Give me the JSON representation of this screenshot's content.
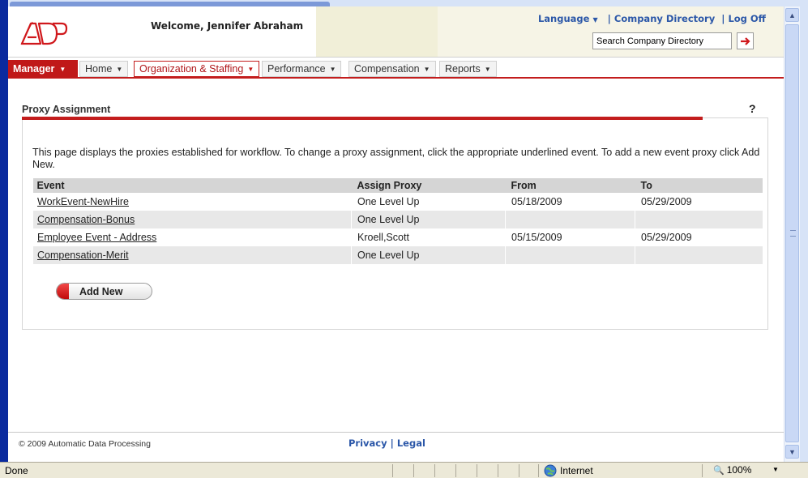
{
  "header": {
    "welcome": "Welcome, Jennifer Abraham",
    "language_label": "Language",
    "company_directory_link": "Company Directory",
    "logoff_link": "Log Off",
    "search_value": "Search Company Directory"
  },
  "nav": {
    "manager": "Manager",
    "home": "Home",
    "organization_staffing": "Organization & Staffing",
    "performance": "Performance",
    "compensation": "Compensation",
    "reports": "Reports"
  },
  "page": {
    "title": "Proxy Assignment",
    "help": "?",
    "intro": "This page displays the proxies established for workflow. To change a proxy assignment, click the appropriate underlined event. To add a new event proxy click Add New.",
    "add_new_label": "Add New"
  },
  "table": {
    "headers": {
      "event": "Event",
      "proxy": "Assign Proxy",
      "from": "From",
      "to": "To"
    },
    "rows": [
      {
        "event": "WorkEvent-NewHire ",
        "proxy": "One Level Up",
        "from": "05/18/2009",
        "to": "05/29/2009"
      },
      {
        "event": "Compensation-Bonus ",
        "proxy": "One Level Up",
        "from": "",
        "to": ""
      },
      {
        "event": "Employee Event - Address ",
        "proxy": "Kroell,Scott",
        "from": "05/15/2009",
        "to": "05/29/2009"
      },
      {
        "event": "Compensation-Merit ",
        "proxy": "One Level Up",
        "from": "",
        "to": ""
      }
    ]
  },
  "footer": {
    "copyright": "© 2009 Automatic Data Processing",
    "privacy": "Privacy",
    "legal": "Legal",
    "separator": "|"
  },
  "statusbar": {
    "status": "Done",
    "zone": "Internet",
    "zoom": "100%"
  },
  "colors": {
    "brand_red": "#c31d1d",
    "link_blue": "#2b57a8"
  }
}
